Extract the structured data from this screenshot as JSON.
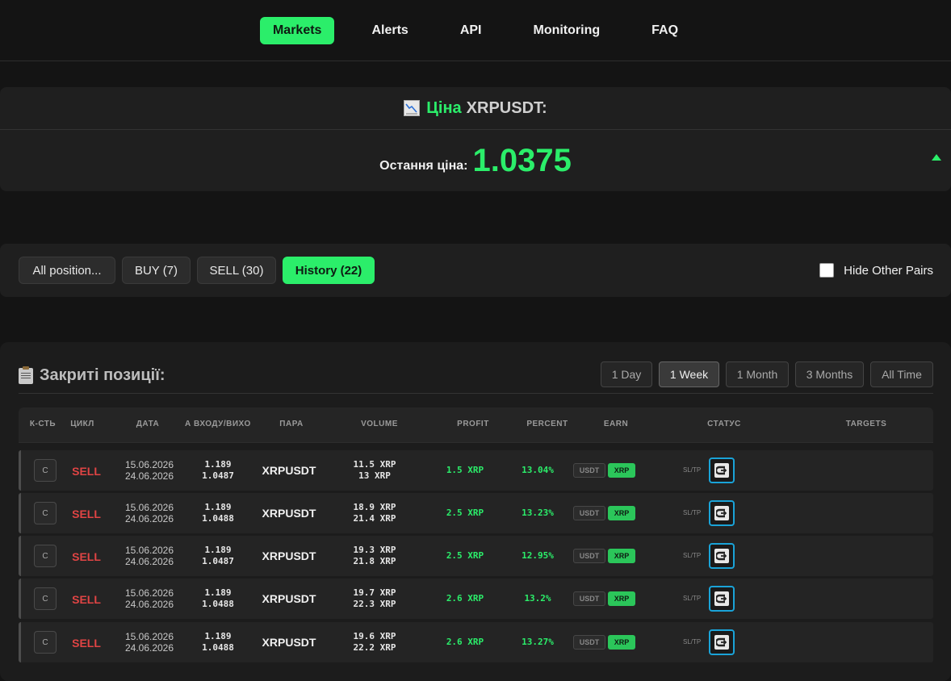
{
  "nav": {
    "items": [
      "Markets",
      "Alerts",
      "API",
      "Monitoring",
      "FAQ"
    ],
    "active": "Markets"
  },
  "price": {
    "label": "Ціна",
    "symbol": "XRPUSDT:",
    "last_label": "Остання ціна:",
    "last_value": "1.0375",
    "trend": "up"
  },
  "filters": {
    "all": "All position...",
    "buy": "BUY (7)",
    "sell": "SELL (30)",
    "history": "History (22)",
    "active": "History (22)",
    "hide_other_pairs": "Hide Other Pairs",
    "hide_other_pairs_checked": false
  },
  "closed": {
    "title": "Закриті позиції:",
    "ranges": [
      "1 Day",
      "1 Week",
      "1 Month",
      "3 Months",
      "All Time"
    ],
    "active_range": "1 Week",
    "headers": [
      "К-СТЬ",
      "ЦИКЛ",
      "ДАТА",
      "А ВХОДУ/ВИХО",
      "ПАРА",
      "VOLUME",
      "PROFIT",
      "PERCENT",
      "EARN",
      "СТАТУС",
      "TARGETS"
    ],
    "rows": [
      {
        "qty": "C",
        "side": "SELL",
        "date_open": "15.06.2026",
        "date_close": "24.06.2026",
        "entry": "1.189",
        "exit": "1.0487",
        "pair": "XRPUSDT",
        "vol1": "11.5 XRP",
        "vol2": "13 XRP",
        "profit": "1.5 XRP",
        "percent": "13.04%",
        "earn1": "USDT",
        "earn2": "XRP",
        "status": "SL/TP"
      },
      {
        "qty": "C",
        "side": "SELL",
        "date_open": "15.06.2026",
        "date_close": "24.06.2026",
        "entry": "1.189",
        "exit": "1.0488",
        "pair": "XRPUSDT",
        "vol1": "18.9 XRP",
        "vol2": "21.4 XRP",
        "profit": "2.5 XRP",
        "percent": "13.23%",
        "earn1": "USDT",
        "earn2": "XRP",
        "status": "SL/TP"
      },
      {
        "qty": "C",
        "side": "SELL",
        "date_open": "15.06.2026",
        "date_close": "24.06.2026",
        "entry": "1.189",
        "exit": "1.0487",
        "pair": "XRPUSDT",
        "vol1": "19.3 XRP",
        "vol2": "21.8 XRP",
        "profit": "2.5 XRP",
        "percent": "12.95%",
        "earn1": "USDT",
        "earn2": "XRP",
        "status": "SL/TP"
      },
      {
        "qty": "C",
        "side": "SELL",
        "date_open": "15.06.2026",
        "date_close": "24.06.2026",
        "entry": "1.189",
        "exit": "1.0488",
        "pair": "XRPUSDT",
        "vol1": "19.7 XRP",
        "vol2": "22.3 XRP",
        "profit": "2.6 XRP",
        "percent": "13.2%",
        "earn1": "USDT",
        "earn2": "XRP",
        "status": "SL/TP"
      },
      {
        "qty": "C",
        "side": "SELL",
        "date_open": "15.06.2026",
        "date_close": "24.06.2026",
        "entry": "1.189",
        "exit": "1.0488",
        "pair": "XRPUSDT",
        "vol1": "19.6 XRP",
        "vol2": "22.2 XRP",
        "profit": "2.6 XRP",
        "percent": "13.27%",
        "earn1": "USDT",
        "earn2": "XRP",
        "status": "SL/TP"
      }
    ]
  }
}
